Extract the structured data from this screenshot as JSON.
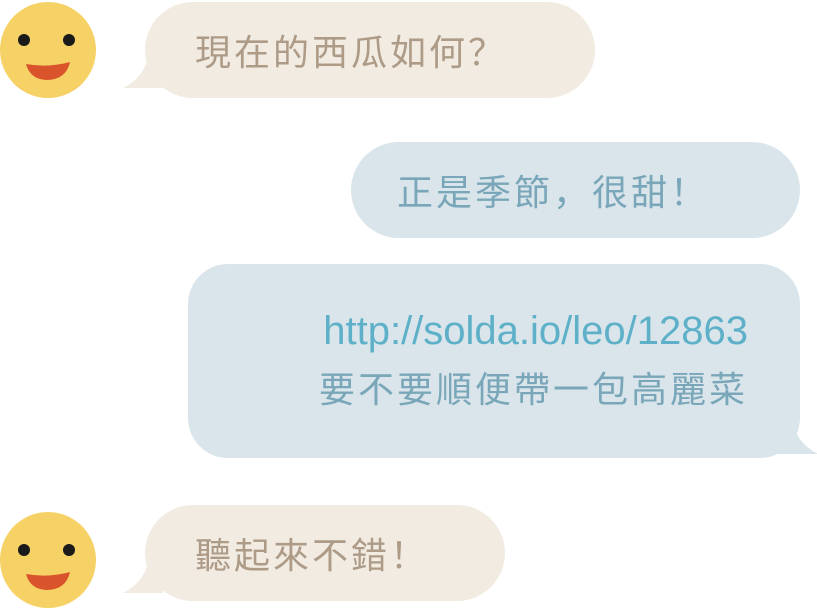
{
  "chat": {
    "messages": [
      {
        "sender": "contact",
        "text": "現在的西瓜如何？"
      },
      {
        "sender": "me",
        "text": "正是季節，很甜！"
      },
      {
        "sender": "me",
        "link": "http://solda.io/leo/12863",
        "text": "要不要順便帶一包高麗菜"
      },
      {
        "sender": "contact",
        "text": "聽起來不錯！"
      }
    ]
  },
  "avatar": {
    "icon": "smiley-face-icon"
  },
  "colors": {
    "incoming_bubble": "#f1ebe2",
    "incoming_text": "#ad9b87",
    "outgoing_bubble": "#d9e5ea",
    "outgoing_text": "#79a6b8",
    "link": "#5eb0c9",
    "avatar_face": "#f6d266",
    "avatar_mouth": "#d9542a"
  }
}
